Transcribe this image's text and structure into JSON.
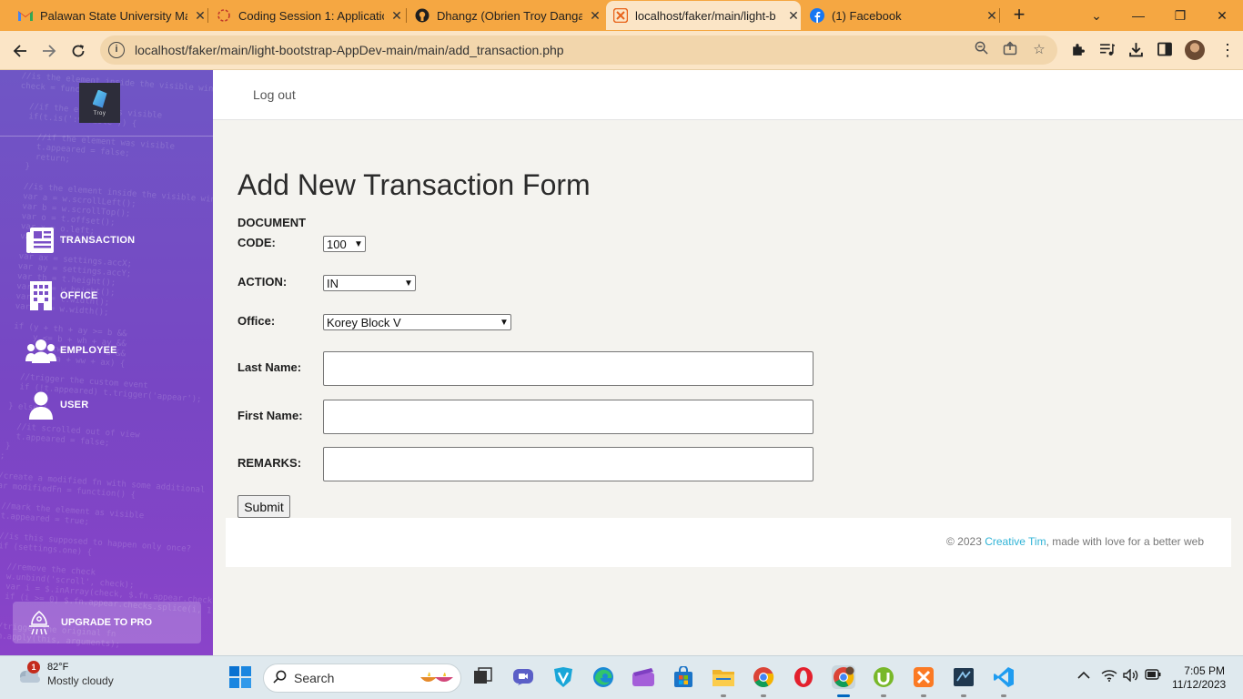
{
  "browser": {
    "tabs": [
      {
        "title": "Palawan State University Ma",
        "icon": "gmail-icon",
        "active": false
      },
      {
        "title": "Coding Session 1: Applicatio",
        "icon": "loading-icon",
        "active": false
      },
      {
        "title": "Dhangz (Obrien Troy Dangan",
        "icon": "github-icon",
        "active": false
      },
      {
        "title": "localhost/faker/main/light-b",
        "icon": "xampp-icon",
        "active": true
      },
      {
        "title": "(1) Facebook",
        "icon": "facebook-icon",
        "active": false
      }
    ],
    "url": "localhost/faker/main/light-bootstrap-AppDev-main/main/add_transaction.php"
  },
  "sidebar": {
    "logo_text": "Troy",
    "items": [
      {
        "label": "TRANSACTION",
        "icon": "newspaper-icon"
      },
      {
        "label": "OFFICE",
        "icon": "building-icon"
      },
      {
        "label": "EMPLOYEE",
        "icon": "users-icon"
      },
      {
        "label": "USER",
        "icon": "user-icon"
      }
    ],
    "upgrade_label": "UPGRADE TO PRO"
  },
  "topnav": {
    "logout": "Log out"
  },
  "form": {
    "title": "Add New Transaction Form",
    "doc_code_label_line1": "DOCUMENT",
    "doc_code_label_line2": "CODE:",
    "doc_code_value": "100",
    "action_label": "ACTION:",
    "action_value": "IN",
    "office_label": "Office:",
    "office_value": "Korey Block V",
    "lastname_label": "Last Name:",
    "lastname_value": "",
    "firstname_label": "First Name:",
    "firstname_value": "",
    "remarks_label": "REMARKS:",
    "remarks_value": "",
    "submit_label": "Submit"
  },
  "footer": {
    "copyright": "© 2023",
    "link": "Creative Tim",
    "tail": ", made with love for a better web"
  },
  "taskbar": {
    "temperature": "82°F",
    "condition": "Mostly cloudy",
    "weather_badge": "1",
    "search_label": "Search",
    "time": "7:05 PM",
    "date": "11/12/2023"
  },
  "colors": {
    "tab_strip": "#f5a742",
    "toolbar": "#fbe5c6",
    "sidebar_top": "#6f56c5",
    "sidebar_bottom": "#8a43c9",
    "footer_link": "#2fb3d6"
  }
}
